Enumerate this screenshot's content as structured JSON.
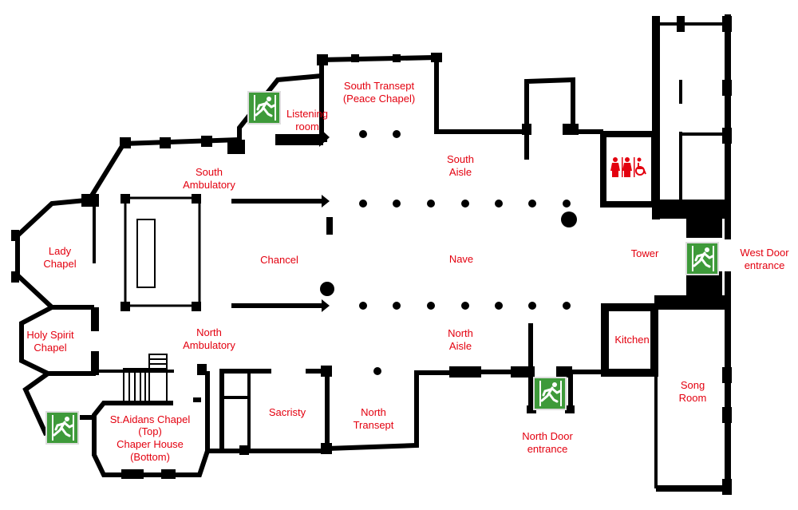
{
  "colors": {
    "label": "#e3000f",
    "exit_sign": "#3e9a3a",
    "walls": "#000000"
  },
  "rooms": {
    "south_transept": [
      "South Transept",
      "(Peace Chapel)"
    ],
    "listening_room": [
      "Listening",
      "room"
    ],
    "south_ambulatory": [
      "South",
      "Ambulatory"
    ],
    "south_aisle": [
      "South",
      "Aisle"
    ],
    "lady_chapel": [
      "Lady",
      "Chapel"
    ],
    "chancel": "Chancel",
    "nave": "Nave",
    "tower": "Tower",
    "west_door": [
      "West Door",
      "entrance"
    ],
    "holy_spirit_chapel": [
      "Holy Spirit",
      "Chapel"
    ],
    "north_ambulatory": [
      "North",
      "Ambulatory"
    ],
    "north_aisle": [
      "North",
      "Aisle"
    ],
    "kitchen": "Kitchen",
    "song_room": [
      "Song",
      "Room"
    ],
    "sacristy": "Sacristy",
    "north_transept": [
      "North",
      "Transept"
    ],
    "st_aidans": [
      "St.Aidans Chapel",
      "(Top)",
      "Chaper House",
      "(Bottom)"
    ],
    "north_door": [
      "North Door",
      "entrance"
    ]
  },
  "icons": {
    "exit": "emergency-exit-running-man-icon",
    "toilets": "toilets-accessible-icon"
  }
}
